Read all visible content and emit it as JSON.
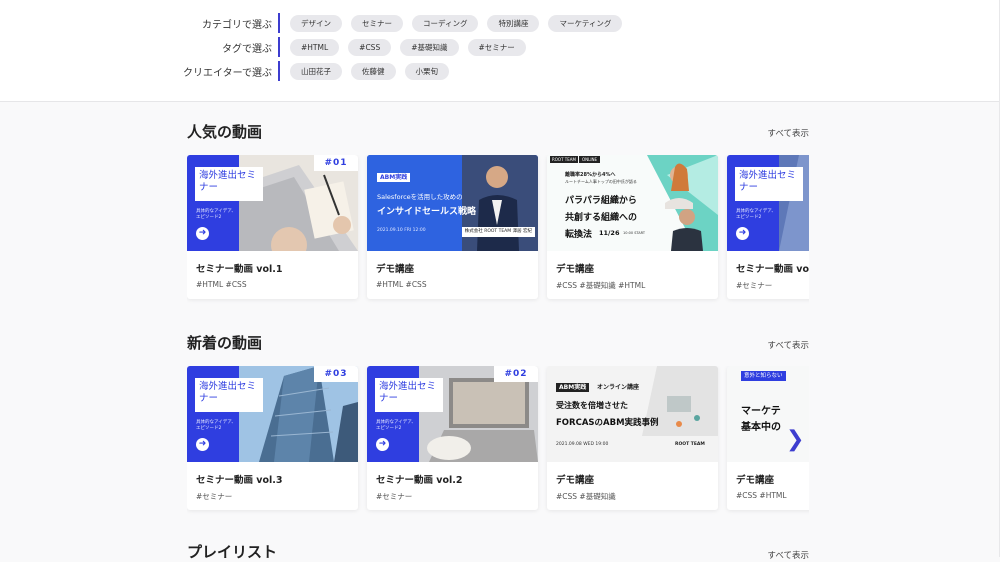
{
  "filters": [
    {
      "label": "カテゴリで選ぶ",
      "chips": [
        "デザイン",
        "セミナー",
        "コーディング",
        "特別講座",
        "マーケティング"
      ]
    },
    {
      "label": "タグで選ぶ",
      "chips": [
        "#HTML",
        "#CSS",
        "#基礎知識",
        "#セミナー"
      ]
    },
    {
      "label": "クリエイターで選ぶ",
      "chips": [
        "山田花子",
        "佐藤健",
        "小栗旬"
      ]
    }
  ],
  "sections": {
    "popular": {
      "title": "人気の動画",
      "see_all": "すべて表示",
      "cards": [
        {
          "title": "セミナー動画 vol.1",
          "tags": "#HTML  #CSS",
          "thumb": {
            "type": "seminar",
            "heading": "海外進出セミナー",
            "sub": "具体的なアイデア、エピソード2",
            "number": "#01"
          }
        },
        {
          "title": "デモ講座",
          "tags": "#HTML  #CSS",
          "thumb": {
            "type": "salesforce",
            "badge": "ABM実践",
            "line1": "Salesforceを活用した攻めの",
            "line2": "インサイドセールス戦略",
            "date": "2021.09.10 FRI 12:00",
            "name": "株式会社 ROOT TEAM 澤居 宏紀"
          }
        },
        {
          "title": "デモ講座",
          "tags": "#CSS  #基礎知識  #HTML",
          "thumb": {
            "type": "parallel",
            "brand": "ROOT TEAM",
            "online": "ONLINE",
            "small": "離職率28%から4%へ",
            "small2": "ルートチーム人事トップの田中氏が語る",
            "line1": "パラパラ組織から",
            "line2": "共創する組織への",
            "line3": "転換法",
            "date": "11/26",
            "time": "10:00 START"
          }
        },
        {
          "title": "セミナー動画 vol",
          "tags": "#セミナー",
          "thumb": {
            "type": "seminar",
            "heading": "海外進出セミナー",
            "sub": "具体的なアイデア、エピソード2",
            "number": ""
          }
        }
      ]
    },
    "newest": {
      "title": "新着の動画",
      "see_all": "すべて表示",
      "cards": [
        {
          "title": "セミナー動画 vol.3",
          "tags": "#セミナー",
          "thumb": {
            "type": "seminar",
            "heading": "海外進出セミナー",
            "sub": "具体的なアイデア、エピソード2",
            "number": "#03"
          }
        },
        {
          "title": "セミナー動画 vol.2",
          "tags": "#セミナー",
          "thumb": {
            "type": "seminar",
            "heading": "海外進出セミナー",
            "sub": "具体的なアイデア、エピソード2",
            "number": "#02"
          }
        },
        {
          "title": "デモ講座",
          "tags": "#CSS  #基礎知識",
          "thumb": {
            "type": "forcas",
            "badge": "ABM実践",
            "badge2": "オンライン講座",
            "line1": "受注数を倍増させた",
            "line2": "FORCASのABM実践事例",
            "date": "2021.09.08 WED 19:00",
            "brand": "ROOT TEAM"
          }
        },
        {
          "title": "デモ講座",
          "tags": "#CSS  #HTML",
          "thumb": {
            "type": "marketing",
            "top": "意外と知らない",
            "line1": "マーケテ",
            "line2": "基本中の"
          }
        }
      ]
    },
    "playlist": {
      "title": "プレイリスト",
      "see_all": "すべて表示"
    }
  },
  "colors": {
    "accent": "#2f3ee0",
    "chip_bg": "#e8e8ec",
    "divider": "#3d3dcf"
  }
}
